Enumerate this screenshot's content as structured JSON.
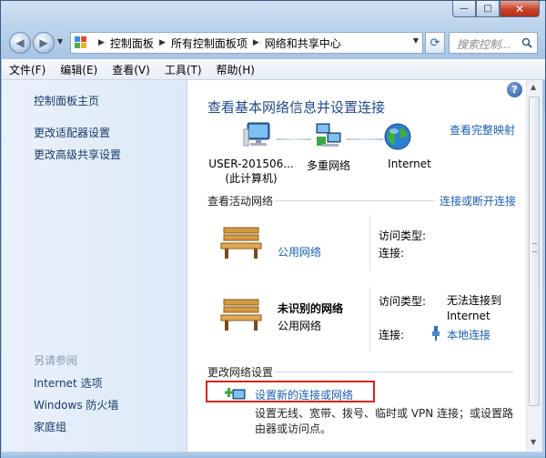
{
  "window": {
    "title": "",
    "controls": {
      "minimize": "—",
      "maximize": "□",
      "close": "✕"
    }
  },
  "nav": {
    "back_icon": "back-arrow-icon",
    "forward_icon": "forward-arrow-icon",
    "breadcrumb": [
      "控制面板",
      "所有控制面板项",
      "网络和共享中心"
    ],
    "search_placeholder": "搜索控制..."
  },
  "menu": [
    "文件(F)",
    "编辑(E)",
    "查看(V)",
    "工具(T)",
    "帮助(H)"
  ],
  "sidebar": {
    "links": [
      "控制面板主页",
      "更改适配器设置",
      "更改高级共享设置"
    ],
    "see_also_heading": "另请参阅",
    "see_also": [
      "Internet 选项",
      "Windows 防火墙",
      "家庭组"
    ]
  },
  "main": {
    "heading": "查看基本网络信息并设置连接",
    "see_full_map": "查看完整映射",
    "nodes": [
      {
        "line1": "USER-201506...",
        "line2": "(此计算机)",
        "icon": "computer-icon"
      },
      {
        "line1": "多重网络",
        "line2": "",
        "icon": "network-icon"
      },
      {
        "line1": "Internet",
        "line2": "",
        "icon": "globe-icon"
      }
    ],
    "active_networks_title": "查看活动网络",
    "connect_disconnect": "连接或断开连接",
    "networks": [
      {
        "name": "",
        "type": "公用网络",
        "access_label": "访问类型:",
        "access_value": "",
        "conn_label": "连接:",
        "conn_value": ""
      },
      {
        "name": "未识别的网络",
        "type": "公用网络",
        "access_label": "访问类型:",
        "access_value": "无法连接到 Internet",
        "conn_label": "连接:",
        "conn_value": "本地连接"
      }
    ],
    "change_settings_title": "更改网络设置",
    "new_connection": "设置新的连接或网络",
    "new_connection_desc": "设置无线、宽带、拨号、临时或 VPN 连接；或设置路由器或访问点。"
  },
  "colors": {
    "link": "#1b5fb6",
    "heading": "#1e4b8c",
    "highlight_border": "#d9241f"
  }
}
